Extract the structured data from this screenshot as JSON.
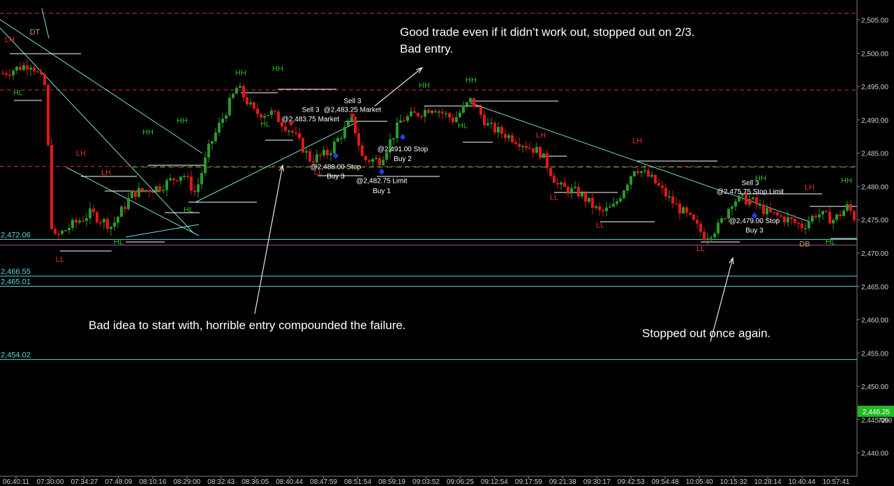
{
  "chart_data": {
    "type": "candlestick",
    "colors": {
      "background": "#000000",
      "up": "#2a9a2a",
      "down": "#e01818",
      "level_line": "#5fd8d8",
      "resistance": "#e03030",
      "support": "#22bb22",
      "trendline": "#7ae0c8",
      "axis": "#808080",
      "label_text": "#ffffff",
      "price_tag": "#22bb22"
    },
    "ylim": [
      2436.5,
      2508
    ],
    "y_ticks": [
      "2,440.00",
      "2,445.00",
      "2,450.00",
      "2,455.00",
      "2,460.00",
      "2,465.00",
      "2,470.00",
      "2,475.00",
      "2,480.00",
      "2,485.00",
      "2,490.00",
      "2,495.00",
      "2,500.00",
      "2,505.00"
    ],
    "x_ticks": [
      "06:40:11",
      "07:30:00",
      "07:34:27",
      "07:48:09",
      "08:10:16",
      "08:29:00",
      "08:32:43",
      "08:36:05",
      "08:40:44",
      "08:47:59",
      "08:51:54",
      "08:59:19",
      "09:03:52",
      "09:06:25",
      "09:12:54",
      "09:17:59",
      "09:21:38",
      "09:30:17",
      "09:42:53",
      "09:54:48",
      "10:05:40",
      "10:15:32",
      "10:28:14",
      "10:40:44",
      "10:57:41"
    ],
    "current_price": "2,446.25",
    "price_tag_sub": "7250",
    "horizontal_levels": [
      {
        "price": 2472.06,
        "label": "2,472.06"
      },
      {
        "price": 2466.55,
        "label": "2,466.55"
      },
      {
        "price": 2465.01,
        "label": "2,465.01"
      },
      {
        "price": 2454.02,
        "label": "2,454.02"
      }
    ],
    "resistance_lines": [
      2494.5,
      2483.0,
      2506.0
    ],
    "support_line": 2483.0,
    "swing_labels": [
      {
        "text": "DT",
        "x": 50,
        "price": 2502.8,
        "color": "#c8a050"
      },
      {
        "text": "LH",
        "x": 14,
        "price": 2501.7,
        "color": "#e03030"
      },
      {
        "text": "HL",
        "x": 26,
        "price": 2493.7,
        "color": "#22bb22"
      },
      {
        "text": "LH",
        "x": 116,
        "price": 2484.6,
        "color": "#e03030"
      },
      {
        "text": "LH",
        "x": 152,
        "price": 2481.7,
        "color": "#e03030"
      },
      {
        "text": "HH",
        "x": 212,
        "price": 2487.8,
        "color": "#22bb22"
      },
      {
        "text": "HH",
        "x": 261,
        "price": 2489.5,
        "color": "#22bb22"
      },
      {
        "text": "HL",
        "x": 270,
        "price": 2476.1,
        "color": "#22bb22"
      },
      {
        "text": "HL",
        "x": 170,
        "price": 2471.3,
        "color": "#22bb22"
      },
      {
        "text": "LL",
        "x": 86,
        "price": 2468.7,
        "color": "#e03030"
      },
      {
        "text": "HH",
        "x": 345,
        "price": 2496.7,
        "color": "#22bb22"
      },
      {
        "text": "HH",
        "x": 398,
        "price": 2497.3,
        "color": "#22bb22"
      },
      {
        "text": "HL",
        "x": 380,
        "price": 2489.0,
        "color": "#22bb22"
      },
      {
        "text": "LL",
        "x": 456,
        "price": 2481.8,
        "color": "#e03030"
      },
      {
        "text": "HH",
        "x": 608,
        "price": 2494.8,
        "color": "#22bb22"
      },
      {
        "text": "HH",
        "x": 675,
        "price": 2495.6,
        "color": "#22bb22"
      },
      {
        "text": "HL",
        "x": 663,
        "price": 2488.8,
        "color": "#22bb22"
      },
      {
        "text": "LH",
        "x": 775,
        "price": 2487.3,
        "color": "#e03030"
      },
      {
        "text": "LL",
        "x": 794,
        "price": 2478.0,
        "color": "#e03030"
      },
      {
        "text": "LL",
        "x": 860,
        "price": 2473.8,
        "color": "#e03030"
      },
      {
        "text": "LH",
        "x": 913,
        "price": 2486.5,
        "color": "#e03030"
      },
      {
        "text": "LL",
        "x": 1004,
        "price": 2470.3,
        "color": "#e03030"
      },
      {
        "text": "HH",
        "x": 1090,
        "price": 2480.9,
        "color": "#22bb22"
      },
      {
        "text": "LH",
        "x": 1160,
        "price": 2479.5,
        "color": "#e03030"
      },
      {
        "text": "HH",
        "x": 1213,
        "price": 2480.5,
        "color": "#22bb22"
      },
      {
        "text": "HL",
        "x": 1190,
        "price": 2471.3,
        "color": "#22bb22"
      },
      {
        "text": "DB",
        "x": 1153,
        "price": 2471.0,
        "color": "#c8a050"
      }
    ],
    "orders": [
      {
        "text": "Sell 3",
        "x": 445,
        "price": 2491.2
      },
      {
        "text": "@2,483.75 Market",
        "x": 445,
        "price": 2489.8
      },
      {
        "text": "Sell 3",
        "x": 505,
        "price": 2492.5
      },
      {
        "text": "@2,483.25 Market",
        "x": 505,
        "price": 2491.2
      },
      {
        "text": "@2,488.00 Stop",
        "x": 481,
        "price": 2482.6
      },
      {
        "text": "Buy 3",
        "x": 481,
        "price": 2481.2
      },
      {
        "text": "@2,491.00 Stop",
        "x": 577,
        "price": 2485.3
      },
      {
        "text": "Buy 2",
        "x": 577,
        "price": 2483.8
      },
      {
        "text": "@2,482.75 Limit",
        "x": 547,
        "price": 2480.5
      },
      {
        "text": "Buy 1",
        "x": 547,
        "price": 2479.0
      },
      {
        "text": "Sell 3",
        "x": 1075,
        "price": 2480.2
      },
      {
        "text": "@2,475.75 Stop Limit",
        "x": 1075,
        "price": 2478.9
      },
      {
        "text": "@2,479.00 Stop",
        "x": 1081,
        "price": 2474.5
      },
      {
        "text": "Buy 3",
        "x": 1081,
        "price": 2473.1
      }
    ],
    "annotations": [
      {
        "lines": [
          "Good trade even if it didn’t work out, stopped out on 2/3.",
          "Bad entry."
        ],
        "x": 573,
        "price": 2502.6
      },
      {
        "lines": [
          "Bad idea to start with, horrible entry compounded the failure."
        ],
        "x": 127,
        "price": 2458.6
      },
      {
        "lines": [
          "Stopped out once again."
        ],
        "x": 920,
        "price": 2457.4
      }
    ]
  }
}
